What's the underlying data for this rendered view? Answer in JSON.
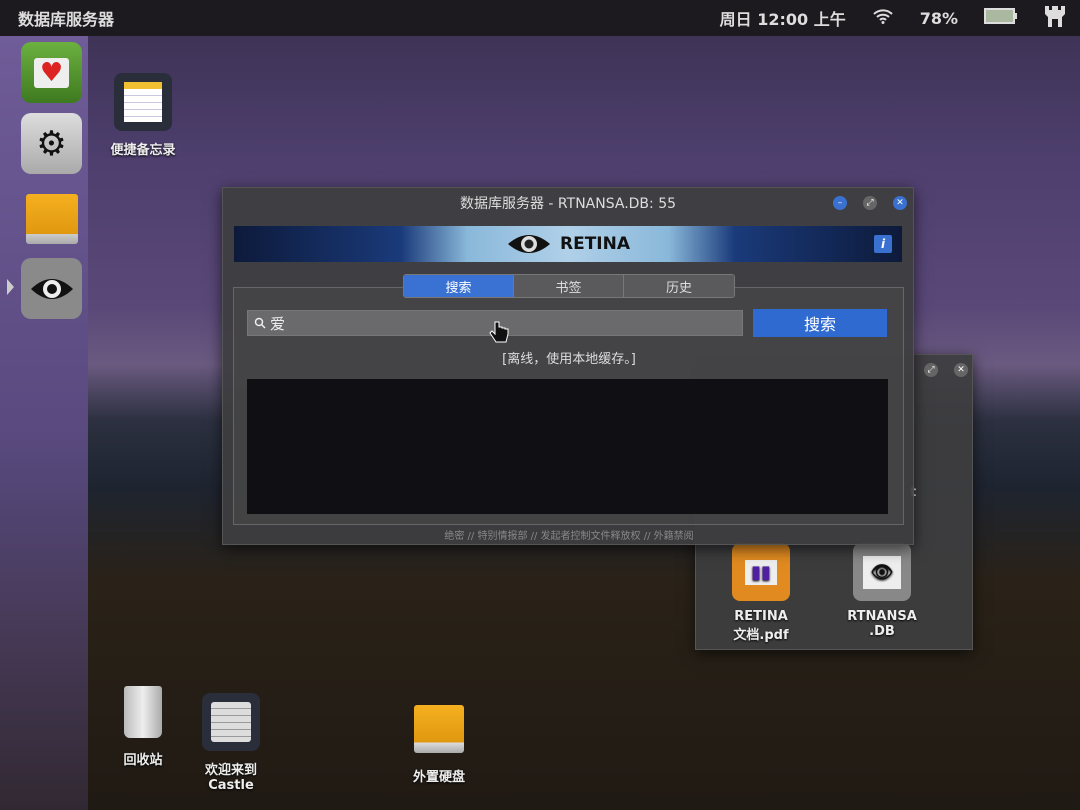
{
  "topbar": {
    "app_title": "数据库服务器",
    "datetime": "周日 12:00 上午",
    "battery": "78%",
    "wifi_icon": "wifi-icon",
    "castle_icon": "castle-icon"
  },
  "dock": [
    {
      "name": "solitaire",
      "glyph": "🂡"
    },
    {
      "name": "settings",
      "glyph": "⚙"
    },
    {
      "name": "external-drive",
      "glyph": ""
    },
    {
      "name": "retina",
      "glyph": "👁"
    }
  ],
  "desktop": {
    "notes": "便捷备忘录",
    "trash": "回收站",
    "welcome_line1": "欢迎来到",
    "welcome_line2": "Castle",
    "drive": "外置硬盘"
  },
  "main_window": {
    "title": "数据库服务器 - RTNANSA.DB: 55",
    "banner": "RETINA",
    "info": "i",
    "tabs": [
      "搜索",
      "书签",
      "历史"
    ],
    "active_tab": 0,
    "search_value": "爱",
    "search_button": "搜索",
    "status": "[离线，使用本地缓存。]",
    "footer": "绝密 // 特别情报部 // 发起者控制文件释放权 // 外籍禁阅"
  },
  "file_window": {
    "partial_text": "t",
    "files": [
      {
        "line1": "RETINA",
        "line2": "文档.pdf"
      },
      {
        "line1": "RTNANSA",
        "line2": ".DB"
      }
    ]
  }
}
